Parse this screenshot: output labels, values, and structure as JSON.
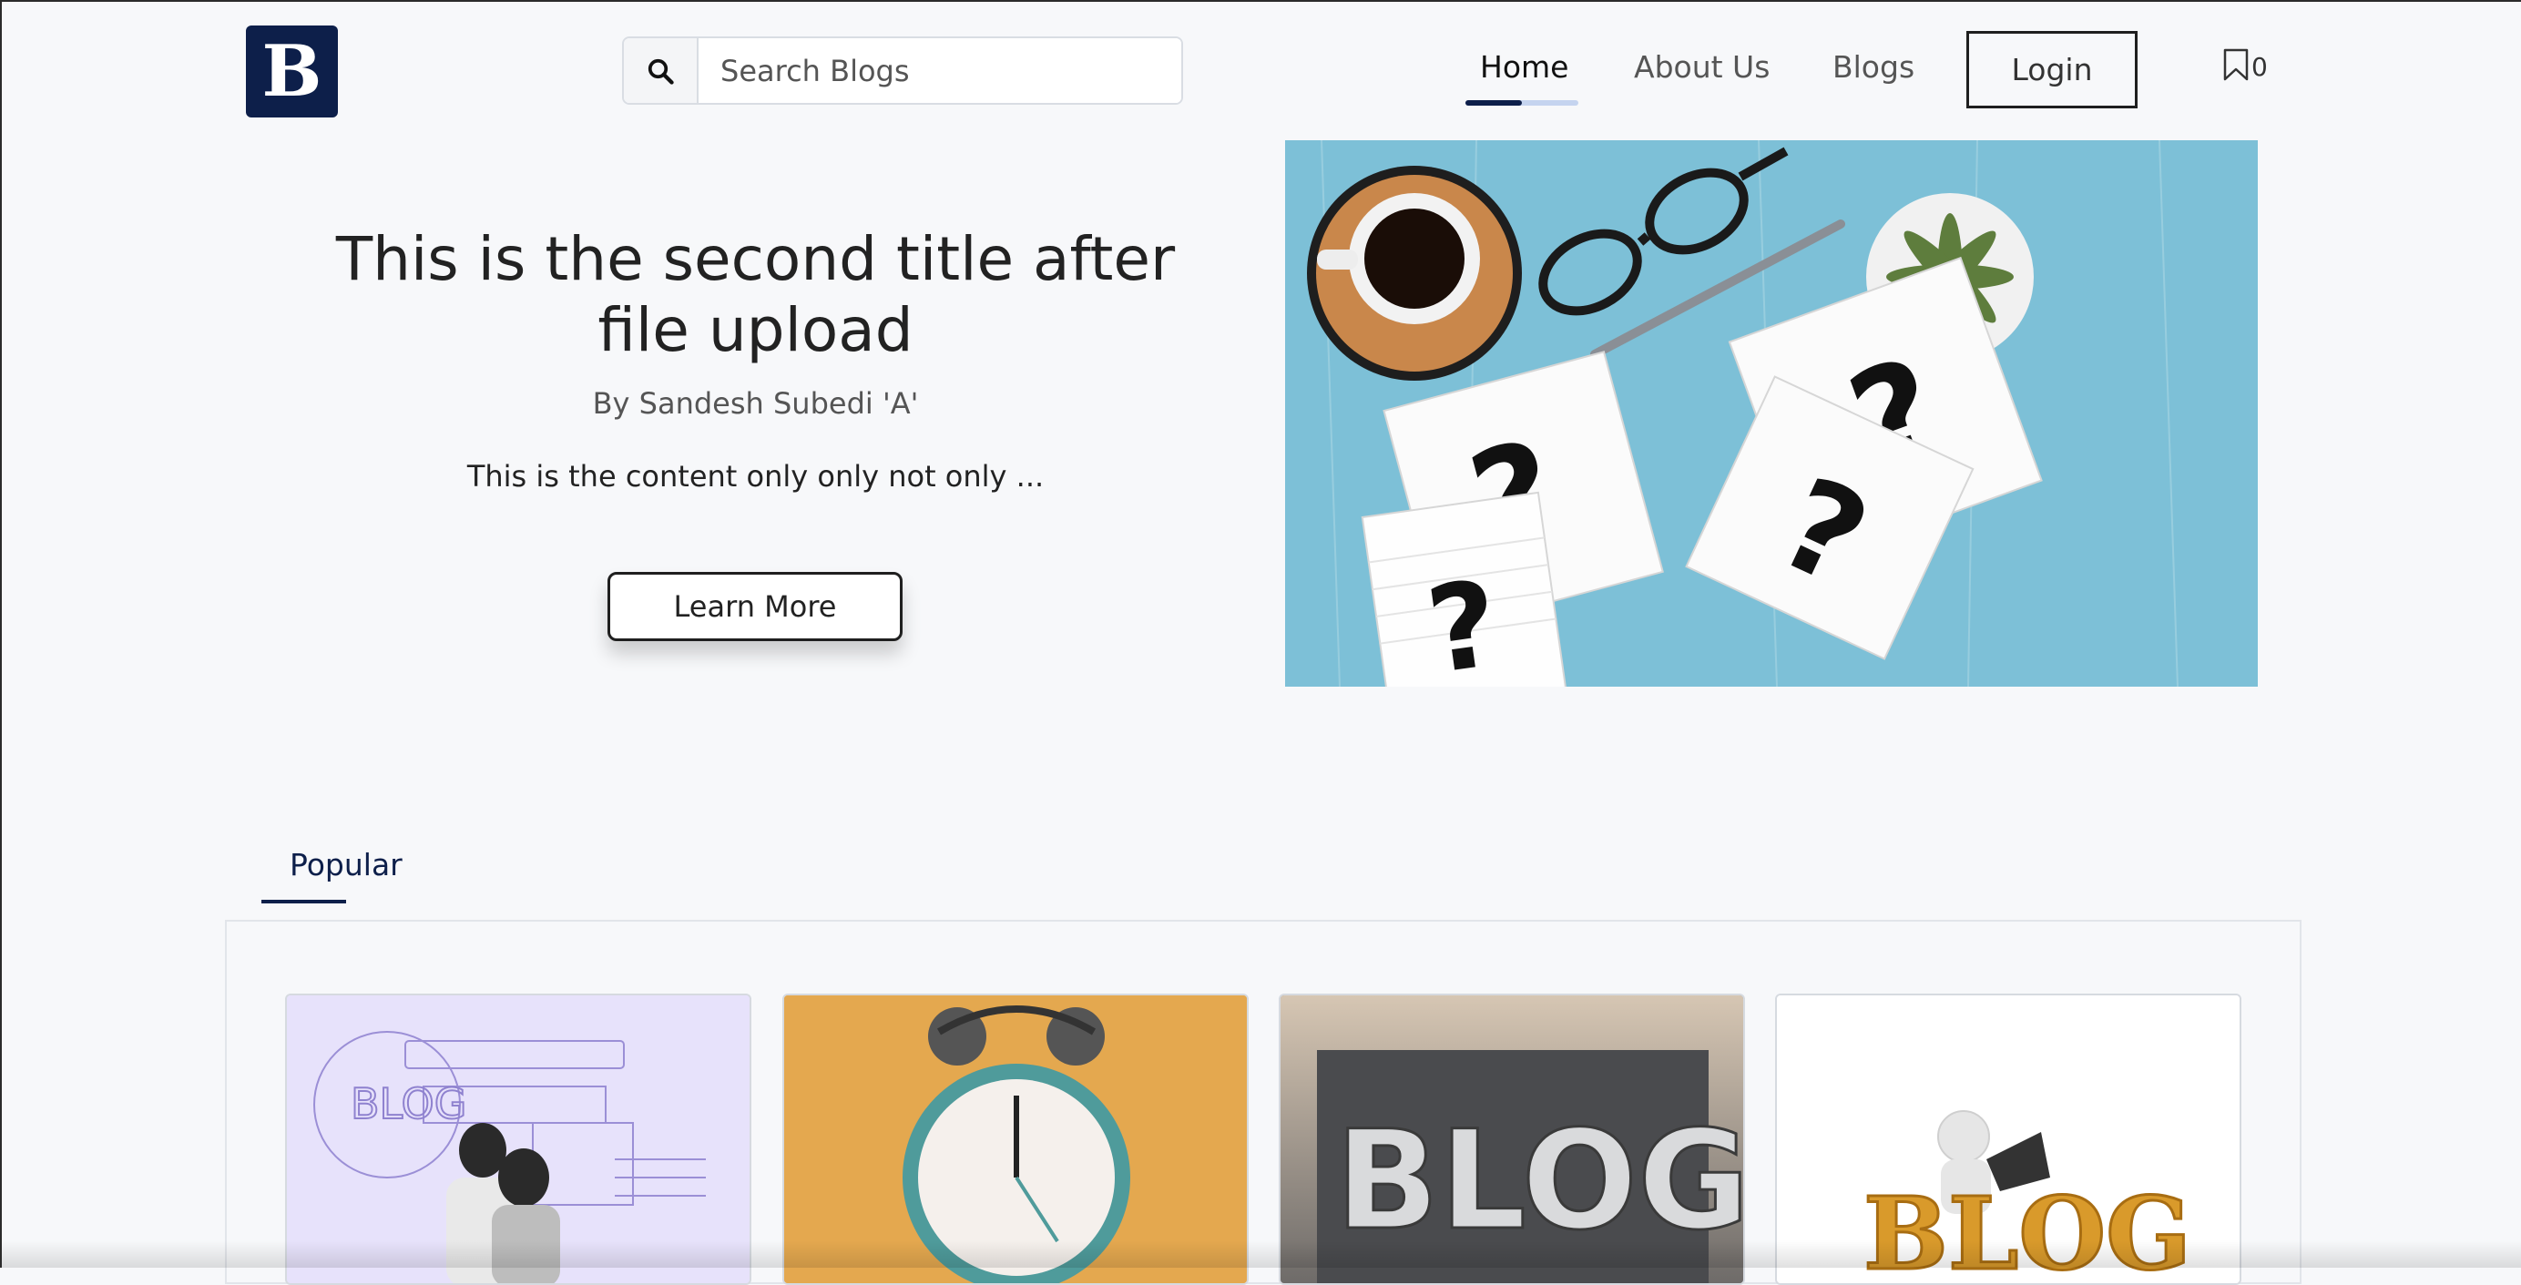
{
  "header": {
    "logo_letter": "B",
    "search": {
      "placeholder": "Search Blogs"
    },
    "nav": {
      "home": "Home",
      "about": "About Us",
      "blogs": "Blogs"
    },
    "login_label": "Login",
    "bookmark_count": "0"
  },
  "hero": {
    "title": "This is the second title after file upload",
    "author": "By Sandesh Subedi 'A'",
    "excerpt": "This is the content only only not only ...",
    "button_label": "Learn More"
  },
  "popular": {
    "tab_label": "Popular",
    "card1_blog_text": "BLOG",
    "card3_blog_text": "BLOG",
    "card4_blog_text": "BLOG"
  },
  "colors": {
    "brand": "#0d1f4a",
    "accent_light": "#c5d4ef",
    "hero_bg": "#7cbfd6"
  }
}
